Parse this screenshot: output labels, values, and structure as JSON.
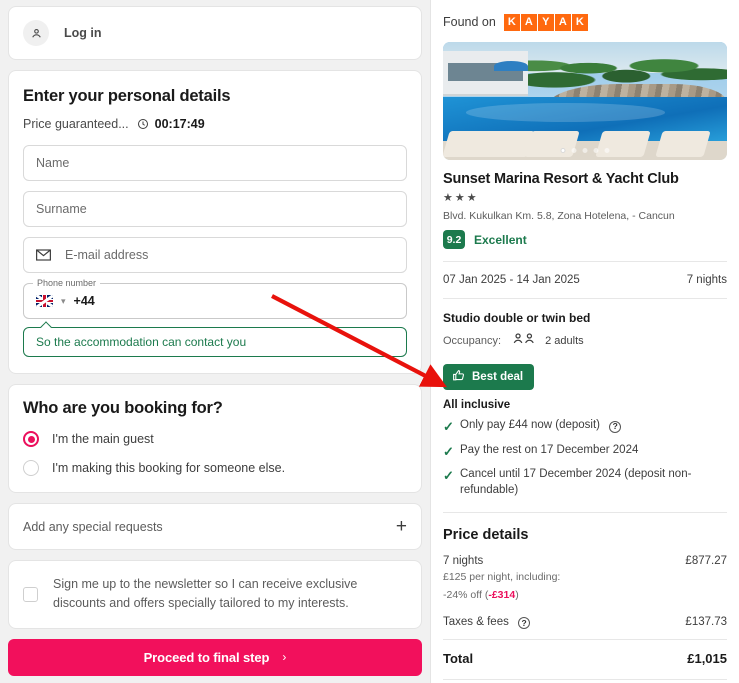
{
  "left": {
    "login": {
      "label": "Log in",
      "icon": "user-icon"
    },
    "details": {
      "title": "Enter your personal details",
      "price_guaranteed": "Price guaranteed...",
      "timer": "00:17:49",
      "name_placeholder": "Name",
      "surname_placeholder": "Surname",
      "email_placeholder": "E-mail address",
      "phone_label": "Phone number",
      "phone_code": "+44",
      "phone_hint": "So the accommodation can contact you"
    },
    "booking_for": {
      "title": "Who are you booking for?",
      "options": [
        {
          "label": "I'm the main guest",
          "selected": true
        },
        {
          "label": "I'm making this booking for someone else.",
          "selected": false
        }
      ]
    },
    "special_requests": {
      "label": "Add any special requests",
      "expand": "+"
    },
    "newsletter": {
      "text": "Sign me up to the newsletter so I can receive exclusive discounts and offers specially tailored to my interests.",
      "checked": false
    },
    "proceed": {
      "label": "Proceed to final step",
      "chevron": "›",
      "color": "#f2105c"
    }
  },
  "right": {
    "found_on": {
      "label": "Found on",
      "brand": "KAYAK",
      "letters": [
        "K",
        "A",
        "Y",
        "A",
        "K"
      ],
      "color": "#ff690f"
    },
    "gallery": {
      "dots": 5,
      "active_dot": 1
    },
    "hotel": {
      "name": "Sunset Marina Resort & Yacht Club",
      "stars": "★★★",
      "star_count": 3,
      "address": "Blvd. Kukulkan Km. 5.8, Zona Hotelena, - Cancun",
      "rating_score": "9.2",
      "rating_word": "Excellent",
      "rating_color": "#1c7a4d"
    },
    "stay": {
      "dates": "07 Jan 2025 - 14 Jan 2025",
      "nights": "7 nights",
      "room": "Studio double or twin bed",
      "occupancy_label": "Occupancy:",
      "occupancy_value": "2 adults"
    },
    "deal": {
      "badge": "Best deal",
      "board": "All inclusive",
      "perks": [
        "Only pay £44 now (deposit)",
        "Pay the rest on 17 December 2024",
        "Cancel until 17 December 2024 (deposit non-refundable)"
      ]
    },
    "price": {
      "title": "Price details",
      "nights_label": "7 nights",
      "nights_value": "£877.27",
      "per_night": "£125 per night, including:",
      "discount_prefix": "-24% off (",
      "discount_value": "-£314",
      "discount_suffix": ")",
      "taxes_label": "Taxes & fees",
      "taxes_value": "£137.73",
      "total_label": "Total",
      "total_value": "£1,015"
    }
  }
}
